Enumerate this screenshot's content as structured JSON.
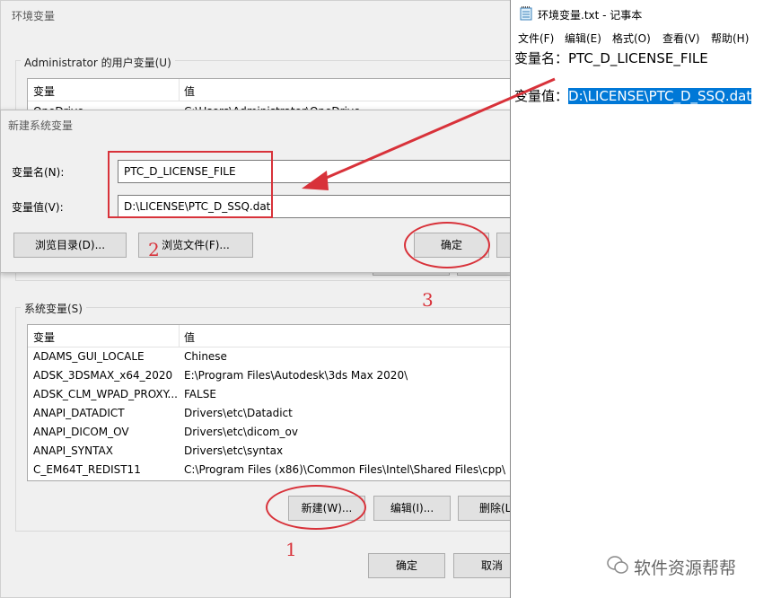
{
  "env_dialog": {
    "title": "环境变量",
    "user_group_label": "Administrator 的用户变量(U)",
    "user_table": {
      "headers": [
        "变量",
        "值"
      ],
      "rows": [
        [
          "OneDrive",
          "C:\\Users\\Administrator\\OneDrive"
        ]
      ]
    },
    "system_group_label": "系统变量(S)",
    "system_table": {
      "headers": [
        "变量",
        "值"
      ],
      "rows": [
        [
          "ADAMS_GUI_LOCALE",
          "Chinese"
        ],
        [
          "ADSK_3DSMAX_x64_2020",
          "E:\\Program Files\\Autodesk\\3ds Max 2020\\"
        ],
        [
          "ADSK_CLM_WPAD_PROXY...",
          "FALSE"
        ],
        [
          "ANAPI_DATADICT",
          "Drivers\\etc\\Datadict"
        ],
        [
          "ANAPI_DICOM_OV",
          "Drivers\\etc\\dicom_ov"
        ],
        [
          "ANAPI_SYNTAX",
          "Drivers\\etc\\syntax"
        ],
        [
          "C_EM64T_REDIST11",
          "C:\\Program Files (x86)\\Common Files\\Intel\\Shared Files\\cpp\\"
        ]
      ]
    },
    "buttons": {
      "new": "新建(W)...",
      "edit": "编辑(I)...",
      "delete": "删除(L)",
      "ok": "确定",
      "cancel": "取消"
    }
  },
  "new_var_dialog": {
    "title": "新建系统变量",
    "name_label": "变量名(N):",
    "name_value": "PTC_D_LICENSE_FILE",
    "value_label": "变量值(V):",
    "value_value": "D:\\LICENSE\\PTC_D_SSQ.dat",
    "buttons": {
      "browse_dir": "浏览目录(D)...",
      "browse_file": "浏览文件(F)...",
      "ok": "确定"
    }
  },
  "notepad": {
    "title": "环境变量.txt - 记事本",
    "menu": [
      "文件(F)",
      "编辑(E)",
      "格式(O)",
      "查看(V)",
      "帮助(H)"
    ],
    "line1_label": "变量名：",
    "line1_value": "PTC_D_LICENSE_FILE",
    "line2_label": "变量值：",
    "line2_value": "D:\\LICENSE\\PTC_D_SSQ.dat"
  },
  "annotations": {
    "step1": "1",
    "step2": "2",
    "step3": "3"
  },
  "watermark": "软件资源帮帮",
  "colors": {
    "annotation_red": "#d8323a",
    "selection_blue": "#0078d7"
  }
}
